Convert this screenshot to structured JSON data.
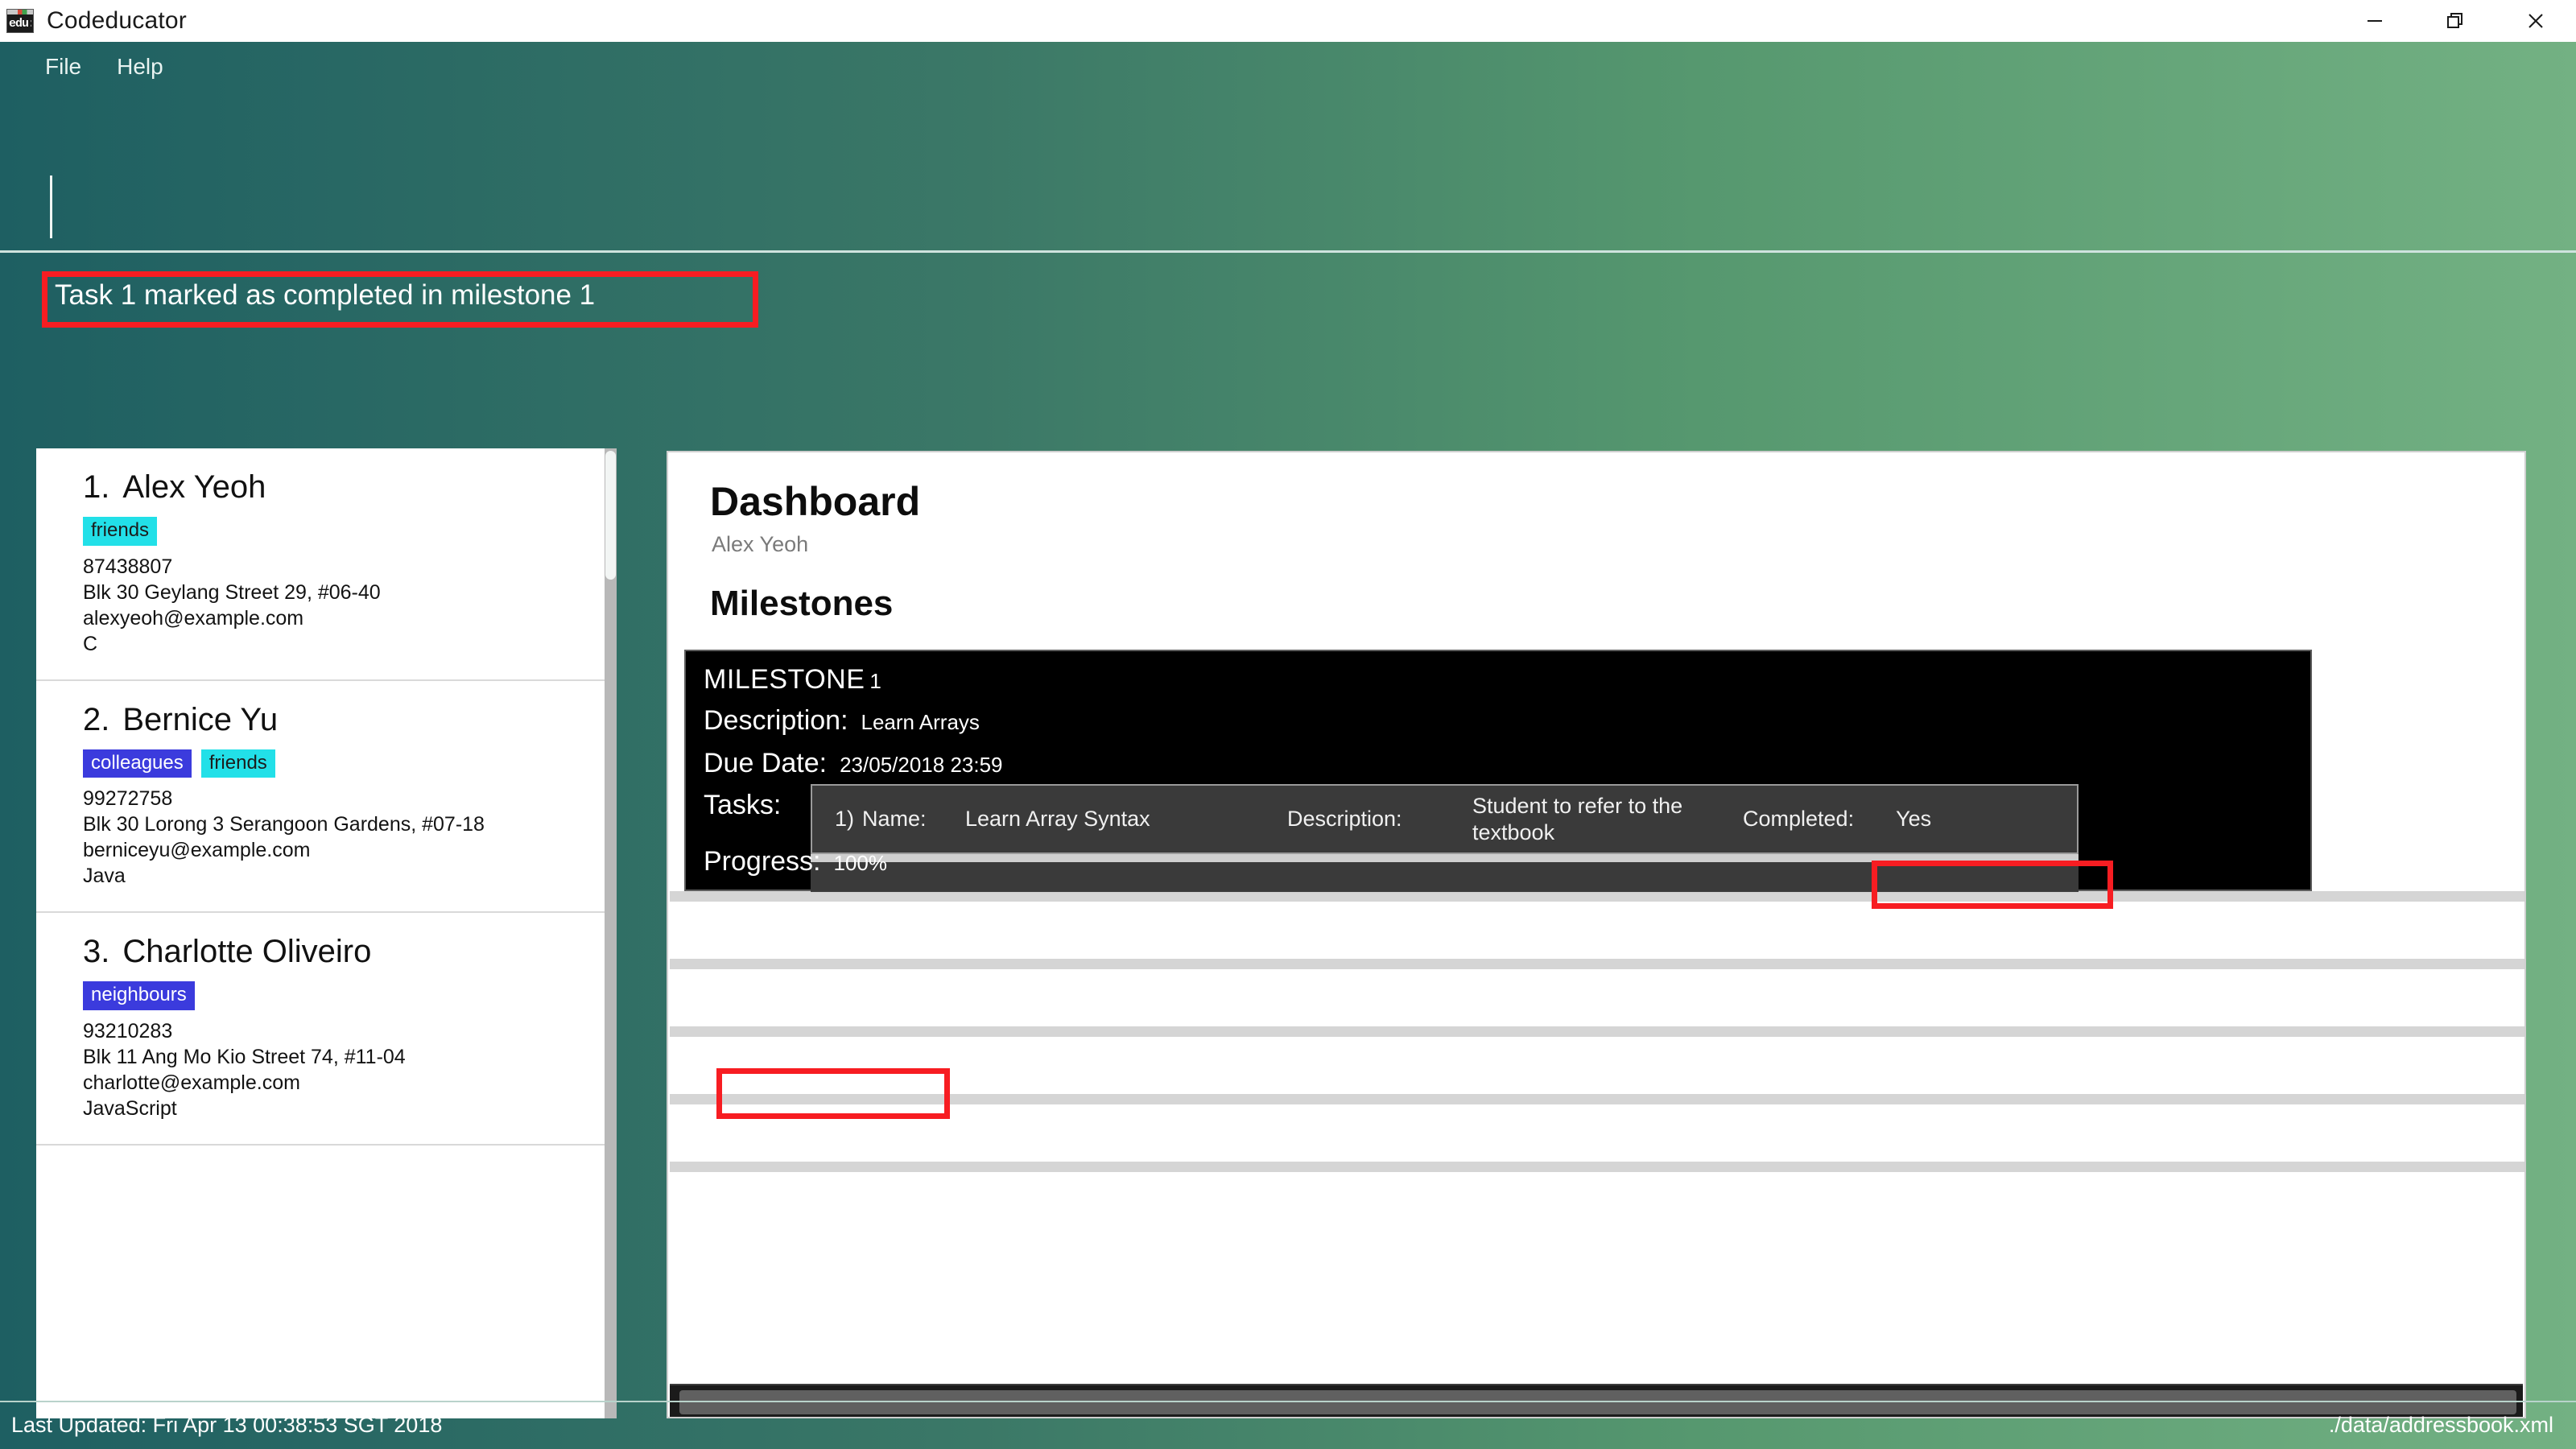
{
  "window": {
    "title": "Codeducator",
    "icon_name": "app-icon",
    "icon_text": "edu:\\",
    "controls": [
      {
        "name": "minimize-button",
        "glyph": "minimize"
      },
      {
        "name": "restore-button",
        "glyph": "restore"
      },
      {
        "name": "close-button",
        "glyph": "close"
      }
    ]
  },
  "menu": {
    "items": [
      {
        "label": "File"
      },
      {
        "label": "Help"
      }
    ]
  },
  "command": {
    "value": "",
    "placeholder": ""
  },
  "result": {
    "text": "Task 1 marked as completed in milestone 1",
    "highlight_color": "#f71d22"
  },
  "persons": [
    {
      "index": "1.",
      "name": "Alex Yeoh",
      "tags": [
        {
          "label": "friends",
          "style": "friends"
        }
      ],
      "phone": "87438807",
      "address": "Blk 30 Geylang Street 29, #06-40",
      "email": "alexyeoh@example.com",
      "language": "C"
    },
    {
      "index": "2.",
      "name": "Bernice Yu",
      "tags": [
        {
          "label": "colleagues",
          "style": "colleagues"
        },
        {
          "label": "friends",
          "style": "friends"
        }
      ],
      "phone": "99272758",
      "address": "Blk 30 Lorong 3 Serangoon Gardens, #07-18",
      "email": "berniceyu@example.com",
      "language": "Java"
    },
    {
      "index": "3.",
      "name": "Charlotte Oliveiro",
      "tags": [
        {
          "label": "neighbours",
          "style": "neighbours"
        }
      ],
      "phone": "93210283",
      "address": "Blk 11 Ang Mo Kio Street 74, #11-04",
      "email": "charlotte@example.com",
      "language": "JavaScript"
    }
  ],
  "dashboard": {
    "title": "Dashboard",
    "subtitle": "Alex Yeoh",
    "section_heading": "Milestones",
    "milestone": {
      "label": "MILESTONE",
      "number": "1",
      "description_key": "Description:",
      "description_value": "Learn Arrays",
      "due_key": "Due Date:",
      "due_value": "23/05/2018 23:59",
      "tasks_key": "Tasks:",
      "tasks": [
        {
          "index": "1)",
          "name_key": "Name:",
          "name_value": "Learn Array Syntax",
          "description_key": "Description:",
          "description_value": "Student to refer to the textbook",
          "completed_key": "Completed:",
          "completed_value": "Yes"
        }
      ],
      "progress_key": "Progress:",
      "progress_value": "100%"
    }
  },
  "statusbar": {
    "last_updated": "Last Updated: Fri Apr 13 00:38:53 SGT 2018",
    "save_location": "./data/addressbook.xml"
  },
  "colors": {
    "accent_teal": "#1e5f62",
    "accent_green": "#73b183",
    "tag_friends": "#22e0e8",
    "tag_colleagues": "#3b3bdd",
    "highlight_red": "#f71d22"
  }
}
